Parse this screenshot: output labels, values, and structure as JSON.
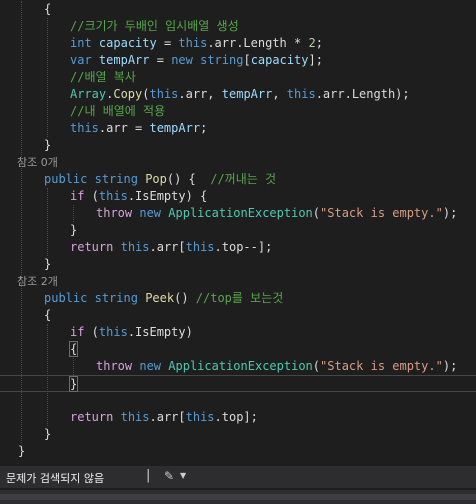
{
  "editor": {
    "lines": [
      {
        "kind": "code",
        "indent": 0,
        "tokens": [
          {
            "t": "{",
            "c": "pl"
          }
        ]
      },
      {
        "kind": "code",
        "indent": 1,
        "tokens": [
          {
            "t": "//크기가 두배인 임시배열 생성",
            "c": "cm"
          }
        ]
      },
      {
        "kind": "code",
        "indent": 1,
        "tokens": [
          {
            "t": "int",
            "c": "kw"
          },
          {
            "t": " ",
            "c": "pl"
          },
          {
            "t": "capacity",
            "c": "var"
          },
          {
            "t": " = ",
            "c": "pl"
          },
          {
            "t": "this",
            "c": "kw"
          },
          {
            "t": ".arr.Length * ",
            "c": "pl"
          },
          {
            "t": "2",
            "c": "num"
          },
          {
            "t": ";",
            "c": "pl"
          }
        ]
      },
      {
        "kind": "code",
        "indent": 1,
        "tokens": [
          {
            "t": "var",
            "c": "kw"
          },
          {
            "t": " ",
            "c": "pl"
          },
          {
            "t": "tempArr",
            "c": "var"
          },
          {
            "t": " = ",
            "c": "pl"
          },
          {
            "t": "new",
            "c": "kw"
          },
          {
            "t": " ",
            "c": "pl"
          },
          {
            "t": "string",
            "c": "kw"
          },
          {
            "t": "[",
            "c": "pl"
          },
          {
            "t": "capacity",
            "c": "var"
          },
          {
            "t": "];",
            "c": "pl"
          }
        ]
      },
      {
        "kind": "code",
        "indent": 1,
        "tokens": [
          {
            "t": "//배열 복사",
            "c": "cm"
          }
        ]
      },
      {
        "kind": "code",
        "indent": 1,
        "tokens": [
          {
            "t": "Array",
            "c": "ty"
          },
          {
            "t": ".",
            "c": "pl"
          },
          {
            "t": "Copy",
            "c": "fn"
          },
          {
            "t": "(",
            "c": "pl"
          },
          {
            "t": "this",
            "c": "kw"
          },
          {
            "t": ".arr, ",
            "c": "pl"
          },
          {
            "t": "tempArr",
            "c": "var"
          },
          {
            "t": ", ",
            "c": "pl"
          },
          {
            "t": "this",
            "c": "kw"
          },
          {
            "t": ".arr.Length);",
            "c": "pl"
          }
        ]
      },
      {
        "kind": "code",
        "indent": 1,
        "tokens": [
          {
            "t": "//내 배열에 적용",
            "c": "cm"
          }
        ]
      },
      {
        "kind": "code",
        "indent": 1,
        "tokens": [
          {
            "t": "this",
            "c": "kw"
          },
          {
            "t": ".arr = ",
            "c": "pl"
          },
          {
            "t": "tempArr",
            "c": "var"
          },
          {
            "t": ";",
            "c": "pl"
          }
        ]
      },
      {
        "kind": "code",
        "indent": 0,
        "tokens": [
          {
            "t": "}",
            "c": "pl"
          }
        ]
      },
      {
        "kind": "lens",
        "text": "참조 0개"
      },
      {
        "kind": "code",
        "indent": 0,
        "tokens": [
          {
            "t": "public",
            "c": "kw"
          },
          {
            "t": " ",
            "c": "pl"
          },
          {
            "t": "string",
            "c": "kw"
          },
          {
            "t": " ",
            "c": "pl"
          },
          {
            "t": "Pop",
            "c": "fn"
          },
          {
            "t": "() {  ",
            "c": "pl"
          },
          {
            "t": "//꺼내는 것",
            "c": "cm"
          }
        ]
      },
      {
        "kind": "code",
        "indent": 1,
        "tokens": [
          {
            "t": "if",
            "c": "kwc"
          },
          {
            "t": " (",
            "c": "pl"
          },
          {
            "t": "this",
            "c": "kw"
          },
          {
            "t": ".IsEmpty) {",
            "c": "pl"
          }
        ]
      },
      {
        "kind": "code",
        "indent": 2,
        "tokens": [
          {
            "t": "throw",
            "c": "kwc"
          },
          {
            "t": " ",
            "c": "pl"
          },
          {
            "t": "new",
            "c": "kw"
          },
          {
            "t": " ",
            "c": "pl"
          },
          {
            "t": "ApplicationException",
            "c": "ty"
          },
          {
            "t": "(",
            "c": "pl"
          },
          {
            "t": "\"Stack is empty.\"",
            "c": "str"
          },
          {
            "t": ");",
            "c": "pl"
          }
        ]
      },
      {
        "kind": "code",
        "indent": 1,
        "tokens": [
          {
            "t": "}",
            "c": "pl"
          }
        ]
      },
      {
        "kind": "code",
        "indent": 1,
        "tokens": [
          {
            "t": "return",
            "c": "kwc"
          },
          {
            "t": " ",
            "c": "pl"
          },
          {
            "t": "this",
            "c": "kw"
          },
          {
            "t": ".arr[",
            "c": "pl"
          },
          {
            "t": "this",
            "c": "kw"
          },
          {
            "t": ".top--];",
            "c": "pl"
          }
        ]
      },
      {
        "kind": "code",
        "indent": 0,
        "tokens": [
          {
            "t": "}",
            "c": "pl"
          }
        ]
      },
      {
        "kind": "lens",
        "text": "참조 2개"
      },
      {
        "kind": "code",
        "indent": 0,
        "tokens": [
          {
            "t": "public",
            "c": "kw"
          },
          {
            "t": " ",
            "c": "pl"
          },
          {
            "t": "string",
            "c": "kw"
          },
          {
            "t": " ",
            "c": "pl"
          },
          {
            "t": "Peek",
            "c": "fn"
          },
          {
            "t": "() ",
            "c": "pl"
          },
          {
            "t": "//top를 보는것",
            "c": "cm"
          }
        ]
      },
      {
        "kind": "code",
        "indent": 0,
        "tokens": [
          {
            "t": "{",
            "c": "pl"
          }
        ]
      },
      {
        "kind": "code",
        "indent": 1,
        "tokens": [
          {
            "t": "if",
            "c": "kwc"
          },
          {
            "t": " (",
            "c": "pl"
          },
          {
            "t": "this",
            "c": "kw"
          },
          {
            "t": ".IsEmpty)",
            "c": "pl"
          }
        ]
      },
      {
        "kind": "code",
        "indent": 1,
        "tokens": [
          {
            "t": "{",
            "c": "pl",
            "bm": true
          }
        ]
      },
      {
        "kind": "code",
        "indent": 2,
        "tokens": [
          {
            "t": "throw",
            "c": "kwc"
          },
          {
            "t": " ",
            "c": "pl"
          },
          {
            "t": "new",
            "c": "kw"
          },
          {
            "t": " ",
            "c": "pl"
          },
          {
            "t": "ApplicationException",
            "c": "ty"
          },
          {
            "t": "(",
            "c": "pl"
          },
          {
            "t": "\"Stack is empty.\"",
            "c": "str"
          },
          {
            "t": ");",
            "c": "pl"
          }
        ]
      },
      {
        "kind": "code",
        "indent": 1,
        "current": true,
        "tokens": [
          {
            "t": "}",
            "c": "pl",
            "bm": true
          }
        ]
      },
      {
        "kind": "code",
        "indent": 1,
        "tokens": []
      },
      {
        "kind": "code",
        "indent": 1,
        "tokens": [
          {
            "t": "return",
            "c": "kwc"
          },
          {
            "t": " ",
            "c": "pl"
          },
          {
            "t": "this",
            "c": "kw"
          },
          {
            "t": ".arr[",
            "c": "pl"
          },
          {
            "t": "this",
            "c": "kw"
          },
          {
            "t": ".top];",
            "c": "pl"
          }
        ]
      },
      {
        "kind": "code",
        "indent": 0,
        "tokens": [
          {
            "t": "}",
            "c": "pl"
          }
        ]
      },
      {
        "kind": "code",
        "indent": -1,
        "tokens": [
          {
            "t": "}",
            "c": "pl"
          }
        ]
      }
    ]
  },
  "status": {
    "issues_text": "문제가 검색되지 않음"
  }
}
